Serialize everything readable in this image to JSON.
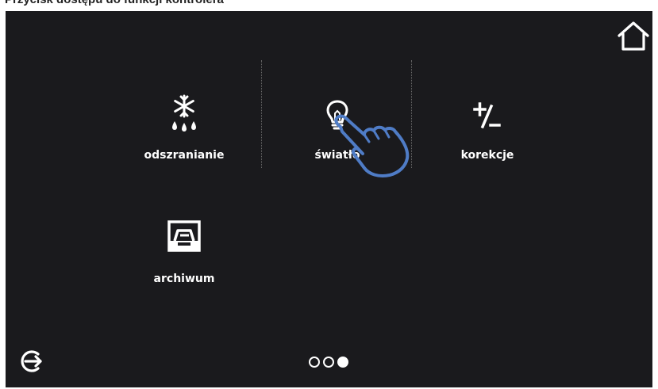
{
  "screen": {
    "title_caption": "Przycisk dostępu do funkcji kontrolera",
    "colors": {
      "background": "#1a1a1d",
      "foreground": "#ffffff",
      "pointer": "#4f7cc6"
    }
  },
  "header": {
    "home_icon": "home-icon"
  },
  "menu": {
    "items": [
      {
        "label": "odszranianie",
        "icon": "defrost-icon"
      },
      {
        "label": "światło",
        "icon": "light-bulb-icon"
      },
      {
        "label": "korekcje",
        "icon": "plus-minus-icon"
      },
      {
        "label": "archiwum",
        "icon": "archive-icon"
      }
    ]
  },
  "footer": {
    "exit_icon": "exit-icon",
    "pagination": {
      "pages": 3,
      "current": 3
    }
  },
  "overlay": {
    "pointer_icon": "pointing-hand-icon"
  }
}
